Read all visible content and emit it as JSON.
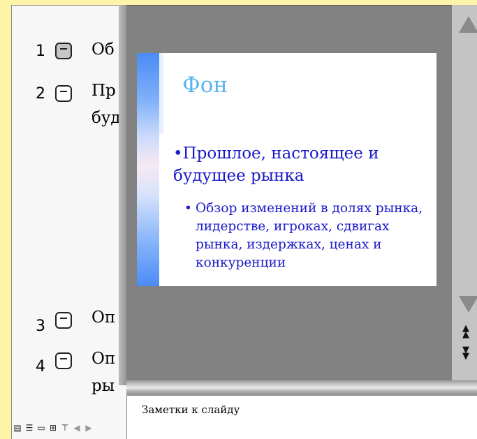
{
  "outline": {
    "items": [
      {
        "num": "1",
        "text": "Об",
        "selected": true
      },
      {
        "num": "2",
        "text": "Пр",
        "text2": "буд",
        "selected": false
      },
      {
        "num": "3",
        "text": "Оп",
        "selected": false
      },
      {
        "num": "4",
        "text": "Оп",
        "text2": "ры",
        "selected": false
      }
    ]
  },
  "view_buttons": [
    "normal-view-icon",
    "outline-view-icon",
    "slide-view-icon",
    "slide-sorter-icon",
    "slideshow-icon",
    "scroll-left-icon",
    "scroll-right-icon"
  ],
  "slide": {
    "title": "Фон",
    "bullet1": "•Прошлое, настоящее и будущее рынка",
    "bullet2_marker": "•",
    "bullet2": "Обзор изменений в долях рынка, лидерстве, игроках, сдвигах рынка, издержках, ценах и конкуренции"
  },
  "notes": {
    "placeholder": "Заметки к слайду"
  },
  "colors": {
    "background": "#fdf4a8",
    "slide_pane": "#828282",
    "title": "#5ab4f0",
    "body_text": "#1a1ac8"
  }
}
